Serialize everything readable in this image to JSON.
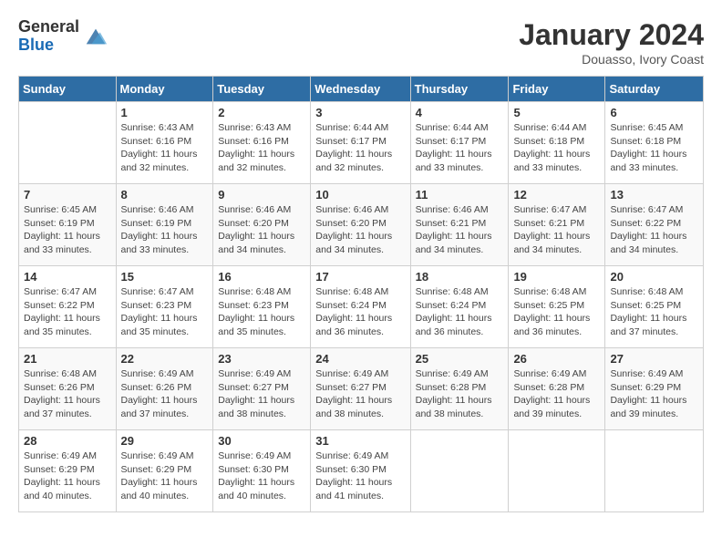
{
  "logo": {
    "general": "General",
    "blue": "Blue"
  },
  "title": {
    "month_year": "January 2024",
    "location": "Douasso, Ivory Coast"
  },
  "days_of_week": [
    "Sunday",
    "Monday",
    "Tuesday",
    "Wednesday",
    "Thursday",
    "Friday",
    "Saturday"
  ],
  "weeks": [
    [
      {
        "day": "",
        "sunrise": "",
        "sunset": "",
        "daylight": ""
      },
      {
        "day": "1",
        "sunrise": "Sunrise: 6:43 AM",
        "sunset": "Sunset: 6:16 PM",
        "daylight": "Daylight: 11 hours and 32 minutes."
      },
      {
        "day": "2",
        "sunrise": "Sunrise: 6:43 AM",
        "sunset": "Sunset: 6:16 PM",
        "daylight": "Daylight: 11 hours and 32 minutes."
      },
      {
        "day": "3",
        "sunrise": "Sunrise: 6:44 AM",
        "sunset": "Sunset: 6:17 PM",
        "daylight": "Daylight: 11 hours and 32 minutes."
      },
      {
        "day": "4",
        "sunrise": "Sunrise: 6:44 AM",
        "sunset": "Sunset: 6:17 PM",
        "daylight": "Daylight: 11 hours and 33 minutes."
      },
      {
        "day": "5",
        "sunrise": "Sunrise: 6:44 AM",
        "sunset": "Sunset: 6:18 PM",
        "daylight": "Daylight: 11 hours and 33 minutes."
      },
      {
        "day": "6",
        "sunrise": "Sunrise: 6:45 AM",
        "sunset": "Sunset: 6:18 PM",
        "daylight": "Daylight: 11 hours and 33 minutes."
      }
    ],
    [
      {
        "day": "7",
        "sunrise": "Sunrise: 6:45 AM",
        "sunset": "Sunset: 6:19 PM",
        "daylight": "Daylight: 11 hours and 33 minutes."
      },
      {
        "day": "8",
        "sunrise": "Sunrise: 6:46 AM",
        "sunset": "Sunset: 6:19 PM",
        "daylight": "Daylight: 11 hours and 33 minutes."
      },
      {
        "day": "9",
        "sunrise": "Sunrise: 6:46 AM",
        "sunset": "Sunset: 6:20 PM",
        "daylight": "Daylight: 11 hours and 34 minutes."
      },
      {
        "day": "10",
        "sunrise": "Sunrise: 6:46 AM",
        "sunset": "Sunset: 6:20 PM",
        "daylight": "Daylight: 11 hours and 34 minutes."
      },
      {
        "day": "11",
        "sunrise": "Sunrise: 6:46 AM",
        "sunset": "Sunset: 6:21 PM",
        "daylight": "Daylight: 11 hours and 34 minutes."
      },
      {
        "day": "12",
        "sunrise": "Sunrise: 6:47 AM",
        "sunset": "Sunset: 6:21 PM",
        "daylight": "Daylight: 11 hours and 34 minutes."
      },
      {
        "day": "13",
        "sunrise": "Sunrise: 6:47 AM",
        "sunset": "Sunset: 6:22 PM",
        "daylight": "Daylight: 11 hours and 34 minutes."
      }
    ],
    [
      {
        "day": "14",
        "sunrise": "Sunrise: 6:47 AM",
        "sunset": "Sunset: 6:22 PM",
        "daylight": "Daylight: 11 hours and 35 minutes."
      },
      {
        "day": "15",
        "sunrise": "Sunrise: 6:47 AM",
        "sunset": "Sunset: 6:23 PM",
        "daylight": "Daylight: 11 hours and 35 minutes."
      },
      {
        "day": "16",
        "sunrise": "Sunrise: 6:48 AM",
        "sunset": "Sunset: 6:23 PM",
        "daylight": "Daylight: 11 hours and 35 minutes."
      },
      {
        "day": "17",
        "sunrise": "Sunrise: 6:48 AM",
        "sunset": "Sunset: 6:24 PM",
        "daylight": "Daylight: 11 hours and 36 minutes."
      },
      {
        "day": "18",
        "sunrise": "Sunrise: 6:48 AM",
        "sunset": "Sunset: 6:24 PM",
        "daylight": "Daylight: 11 hours and 36 minutes."
      },
      {
        "day": "19",
        "sunrise": "Sunrise: 6:48 AM",
        "sunset": "Sunset: 6:25 PM",
        "daylight": "Daylight: 11 hours and 36 minutes."
      },
      {
        "day": "20",
        "sunrise": "Sunrise: 6:48 AM",
        "sunset": "Sunset: 6:25 PM",
        "daylight": "Daylight: 11 hours and 37 minutes."
      }
    ],
    [
      {
        "day": "21",
        "sunrise": "Sunrise: 6:48 AM",
        "sunset": "Sunset: 6:26 PM",
        "daylight": "Daylight: 11 hours and 37 minutes."
      },
      {
        "day": "22",
        "sunrise": "Sunrise: 6:49 AM",
        "sunset": "Sunset: 6:26 PM",
        "daylight": "Daylight: 11 hours and 37 minutes."
      },
      {
        "day": "23",
        "sunrise": "Sunrise: 6:49 AM",
        "sunset": "Sunset: 6:27 PM",
        "daylight": "Daylight: 11 hours and 38 minutes."
      },
      {
        "day": "24",
        "sunrise": "Sunrise: 6:49 AM",
        "sunset": "Sunset: 6:27 PM",
        "daylight": "Daylight: 11 hours and 38 minutes."
      },
      {
        "day": "25",
        "sunrise": "Sunrise: 6:49 AM",
        "sunset": "Sunset: 6:28 PM",
        "daylight": "Daylight: 11 hours and 38 minutes."
      },
      {
        "day": "26",
        "sunrise": "Sunrise: 6:49 AM",
        "sunset": "Sunset: 6:28 PM",
        "daylight": "Daylight: 11 hours and 39 minutes."
      },
      {
        "day": "27",
        "sunrise": "Sunrise: 6:49 AM",
        "sunset": "Sunset: 6:29 PM",
        "daylight": "Daylight: 11 hours and 39 minutes."
      }
    ],
    [
      {
        "day": "28",
        "sunrise": "Sunrise: 6:49 AM",
        "sunset": "Sunset: 6:29 PM",
        "daylight": "Daylight: 11 hours and 40 minutes."
      },
      {
        "day": "29",
        "sunrise": "Sunrise: 6:49 AM",
        "sunset": "Sunset: 6:29 PM",
        "daylight": "Daylight: 11 hours and 40 minutes."
      },
      {
        "day": "30",
        "sunrise": "Sunrise: 6:49 AM",
        "sunset": "Sunset: 6:30 PM",
        "daylight": "Daylight: 11 hours and 40 minutes."
      },
      {
        "day": "31",
        "sunrise": "Sunrise: 6:49 AM",
        "sunset": "Sunset: 6:30 PM",
        "daylight": "Daylight: 11 hours and 41 minutes."
      },
      {
        "day": "",
        "sunrise": "",
        "sunset": "",
        "daylight": ""
      },
      {
        "day": "",
        "sunrise": "",
        "sunset": "",
        "daylight": ""
      },
      {
        "day": "",
        "sunrise": "",
        "sunset": "",
        "daylight": ""
      }
    ]
  ]
}
